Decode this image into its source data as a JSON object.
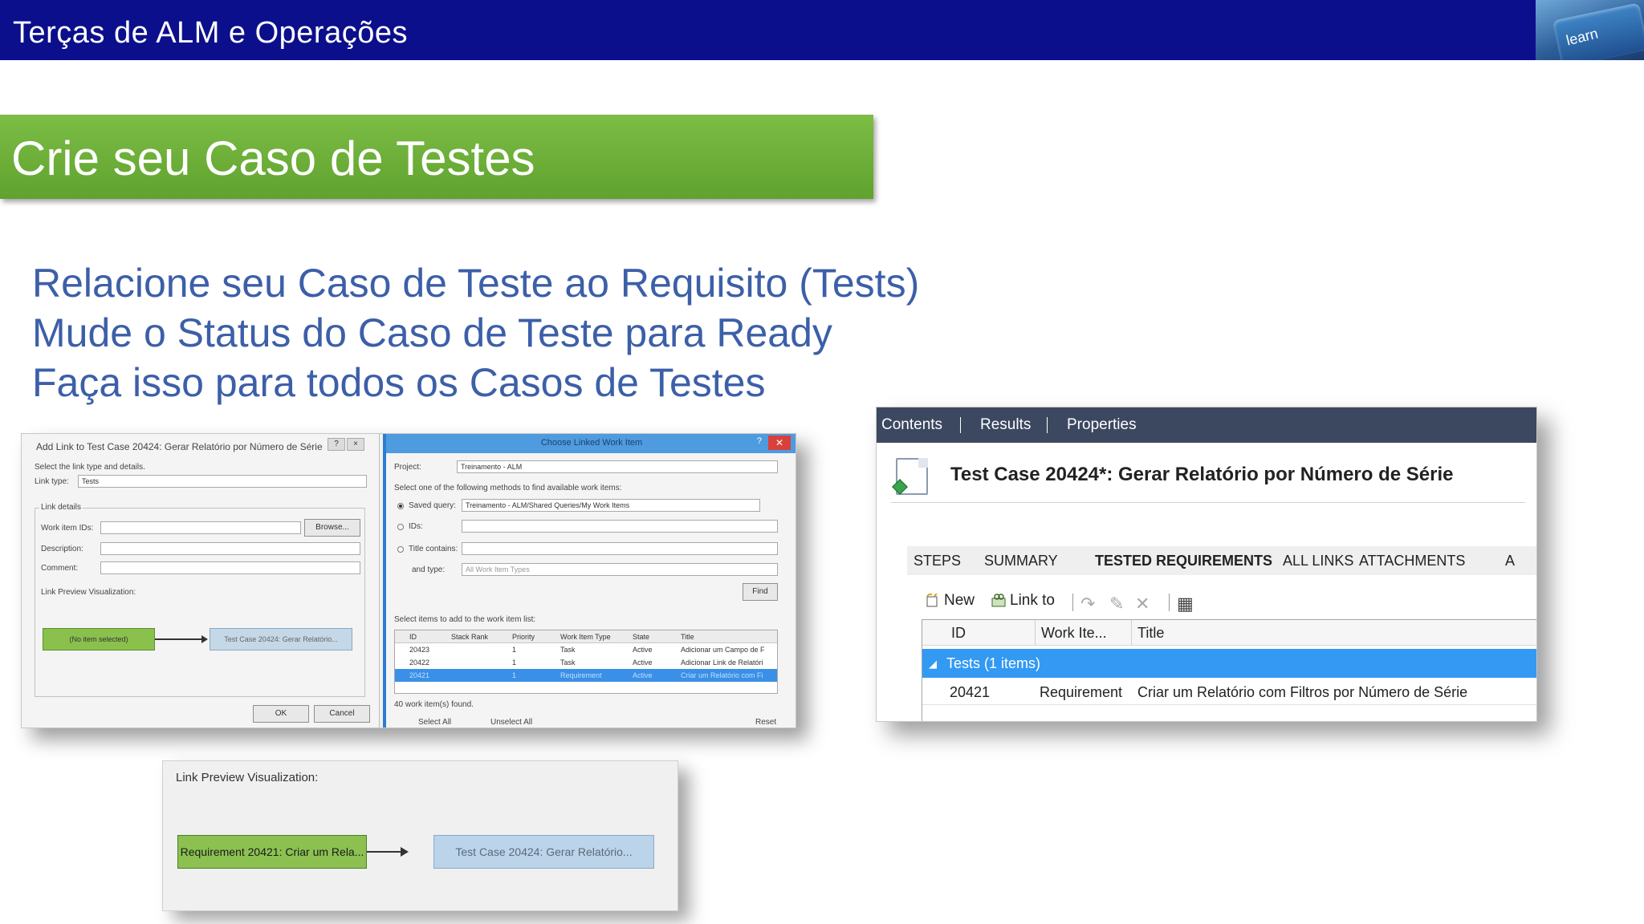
{
  "header": {
    "title": "Terças de ALM e Operações",
    "badge_text": "learn"
  },
  "section": {
    "title": "Crie seu Caso de Testes"
  },
  "bullets": [
    "Relacione seu Caso de Teste ao Requisito (Tests)",
    "Mude o Status do Caso de Teste para Ready",
    "Faça isso para todos os Casos de Testes"
  ],
  "add_link_dialog": {
    "title": "Add Link to Test Case 20424: Gerar Relatório por Número de Série",
    "help": "?",
    "close": "×",
    "instruction": "Select the link type and details.",
    "link_type_label": "Link type:",
    "link_type_value": "Tests",
    "link_details_label": "Link details",
    "work_item_ids_label": "Work item IDs:",
    "browse_button": "Browse...",
    "description_label": "Description:",
    "comment_label": "Comment:",
    "preview_label": "Link Preview Visualization:",
    "preview_source": "(No item selected)",
    "preview_target": "Test Case 20424: Gerar Relatório...",
    "ok_button": "OK",
    "cancel_button": "Cancel"
  },
  "choose_dialog": {
    "title": "Choose Linked Work Item",
    "help": "?",
    "close": "✕",
    "project_label": "Project:",
    "project_value": "Treinamento - ALM",
    "methods_label": "Select one of the following methods to find available work items:",
    "saved_query_label": "Saved query:",
    "saved_query_value": "Treinamento - ALM/Shared Queries/My Work Items",
    "ids_label": "IDs:",
    "title_contains_label": "Title contains:",
    "and_type_label": "and type:",
    "and_type_value": "All Work Item Types",
    "find_button": "Find",
    "items_label": "Select items to add to the work item list:",
    "columns": [
      "ID",
      "Stack Rank",
      "Priority",
      "Work Item Type",
      "State",
      "Title"
    ],
    "rows": [
      [
        "20423",
        "",
        "1",
        "Task",
        "Active",
        "Adicionar um Campo de F"
      ],
      [
        "20422",
        "",
        "1",
        "Task",
        "Active",
        "Adicionar Link de Relatóri"
      ],
      [
        "20421",
        "",
        "1",
        "Requirement",
        "Active",
        "Criar um Relatório com Fi"
      ]
    ],
    "found_text": "40 work item(s) found.",
    "select_all": "Select All",
    "unselect_all": "Unselect All",
    "reset": "Reset"
  },
  "test_case_panel": {
    "tabs": [
      "Contents",
      "Results",
      "Properties"
    ],
    "title": "Test Case 20424*: Gerar Relatório por Número de Série",
    "subtabs": [
      "STEPS",
      "SUMMARY",
      "TESTED REQUIREMENTS",
      "ALL LINKS",
      "ATTACHMENTS",
      "A"
    ],
    "active_subtab": "TESTED REQUIREMENTS",
    "toolbar": {
      "new_label": "New",
      "link_to_label": "Link to"
    },
    "columns": [
      "ID",
      "Work Ite...",
      "Title"
    ],
    "group_label": "Tests (1 items)",
    "rows": [
      {
        "id": "20421",
        "type": "Requirement",
        "title": "Criar um Relatório com Filtros por Número de Série"
      }
    ]
  },
  "link_preview": {
    "label": "Link Preview Visualization:",
    "source": "Requirement 20421: Criar um Rela...",
    "target": "Test Case 20424: Gerar Relatório..."
  },
  "colors": {
    "banner": "#0c0f8c",
    "section_green": "#6aaa36",
    "bullet_text": "#3c5fa8",
    "selection_blue": "#3399f3",
    "tabbar": "#3c4860"
  }
}
